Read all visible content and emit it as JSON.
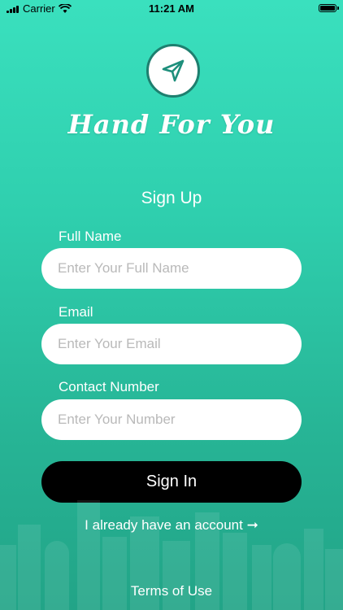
{
  "status_bar": {
    "carrier": "Carrier",
    "time": "11:21 AM"
  },
  "brand": {
    "name": "Hand For You",
    "logo_icon": "paper-plane-icon"
  },
  "screen": {
    "title": "Sign Up"
  },
  "form": {
    "full_name": {
      "label": "Full Name",
      "placeholder": "Enter Your Full Name",
      "value": ""
    },
    "email": {
      "label": "Email",
      "placeholder": "Enter Your Email",
      "value": ""
    },
    "contact": {
      "label": "Contact Number",
      "placeholder": "Enter Your Number",
      "value": ""
    }
  },
  "actions": {
    "primary_label": "Sign In",
    "account_link": "I already have an account ➞"
  },
  "footer": {
    "terms": "Terms of Use"
  },
  "colors": {
    "gradient_top": "#3ae0be",
    "gradient_bottom": "#22a487",
    "button_bg": "#000000",
    "input_bg": "#ffffff",
    "logo_ring": "#1e7f6f"
  }
}
